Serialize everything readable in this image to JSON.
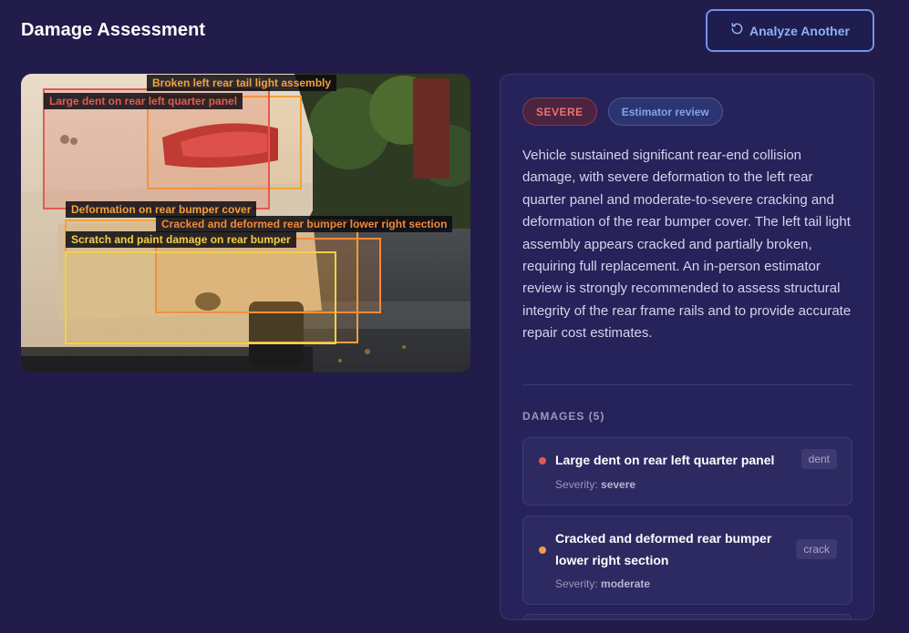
{
  "header": {
    "title": "Damage Assessment",
    "analyze_button": "Analyze Another"
  },
  "image": {
    "annotations": [
      {
        "label": "Broken left rear tail light assembly",
        "color": "#f4a13c"
      },
      {
        "label": "Large dent on rear left quarter panel",
        "color": "#e35a52"
      },
      {
        "label": "Deformation on rear bumper cover",
        "color": "#f4a13c"
      },
      {
        "label": "Cracked and deformed rear bumper lower right section",
        "color": "#f08a3c"
      },
      {
        "label": "Scratch and paint damage on rear bumper",
        "color": "#f2d04a"
      }
    ]
  },
  "assessment": {
    "severity_badge": "SEVERE",
    "review_badge": "Estimator review",
    "summary": "Vehicle sustained significant rear-end collision damage, with severe deformation to the left rear quarter panel and moderate-to-severe cracking and deformation of the rear bumper cover. The left tail light assembly appears cracked and partially broken, requiring full replacement. An in-person estimator review is strongly recommended to assess structural integrity of the rear frame rails and to provide accurate repair cost estimates.",
    "damages_heading": "DAMAGES (5)",
    "severity_prefix": "Severity:",
    "damages": [
      {
        "name": "Large dent on rear left quarter panel",
        "severity": "severe",
        "tag": "dent",
        "dot_color": "#e85454"
      },
      {
        "name": "Cracked and deformed rear bumper lower right section",
        "severity": "moderate",
        "tag": "crack",
        "dot_color": "#f09a44"
      }
    ]
  },
  "colors": {
    "background": "#211c4a",
    "accent": "#6f93ec",
    "severe": "#f07070"
  }
}
